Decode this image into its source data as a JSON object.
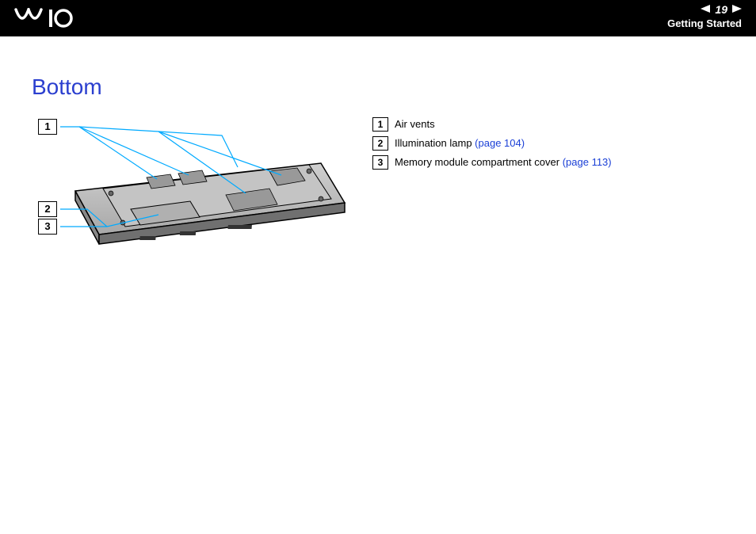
{
  "header": {
    "logo_alt": "VAIO",
    "page_number": "19",
    "section": "Getting Started"
  },
  "title": "Bottom",
  "diagram": {
    "callouts": [
      "1",
      "2",
      "3"
    ]
  },
  "legend": [
    {
      "num": "1",
      "text": "Air vents",
      "link": ""
    },
    {
      "num": "2",
      "text": "Illumination lamp",
      "link": "(page 104)"
    },
    {
      "num": "3",
      "text": "Memory module compartment cover",
      "link": "(page 113)"
    }
  ]
}
